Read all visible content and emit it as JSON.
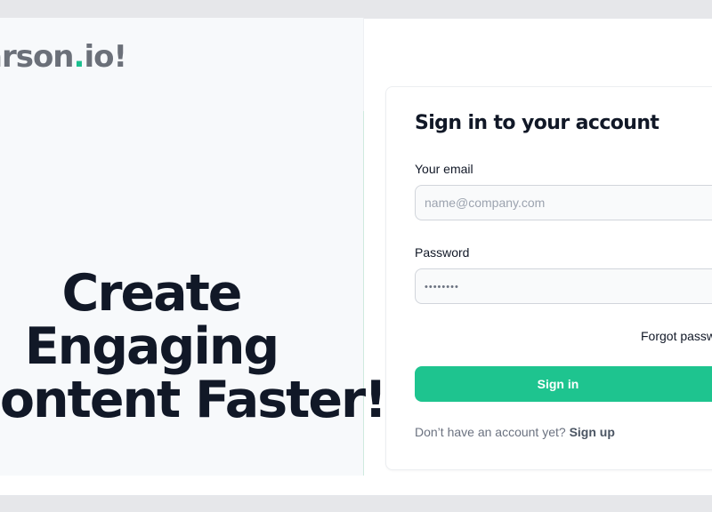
{
  "brand": {
    "logo_main": "arson",
    "logo_dot": ".",
    "logo_tail": "io!",
    "accent_color": "#1bbf8f"
  },
  "hero": {
    "line1": "Create",
    "line2": "Engaging",
    "line3": "Content Faster!"
  },
  "signin": {
    "title": "Sign in to your account",
    "email_label": "Your email",
    "email_placeholder": "name@company.com",
    "password_label": "Password",
    "password_value": "••••••••",
    "forgot_label": "Forgot passw",
    "button_label": "Sign in",
    "no_account_text": "Don’t have an account yet?",
    "signup_link": "Sign up",
    "button_color": "#1ec48f"
  }
}
